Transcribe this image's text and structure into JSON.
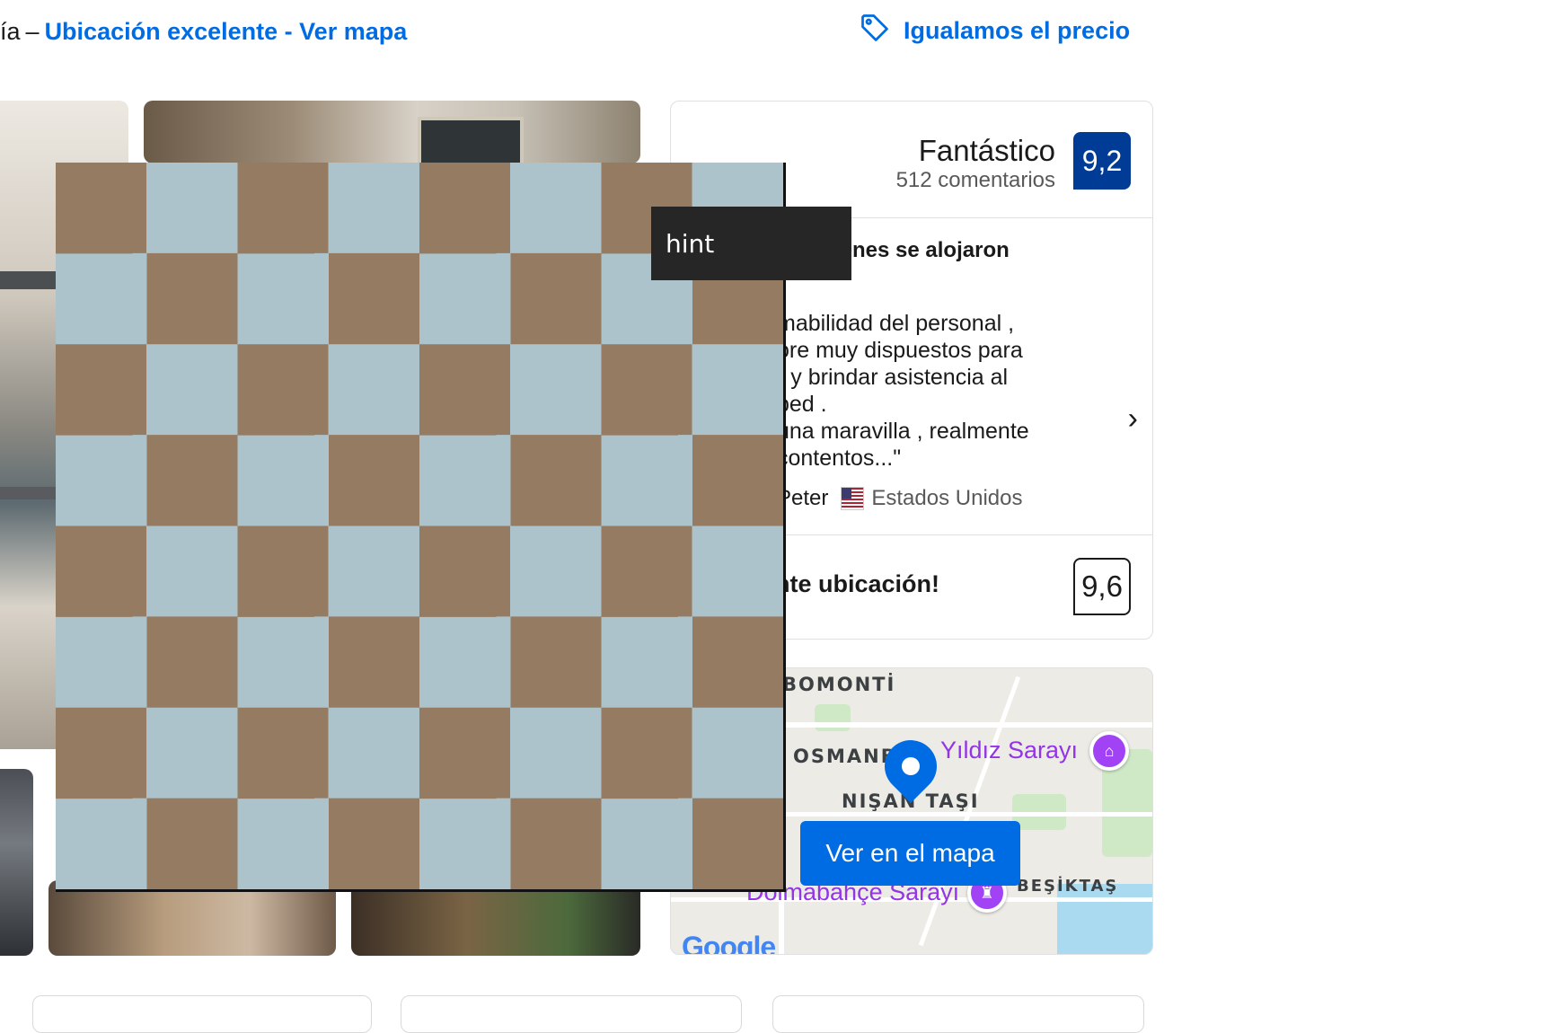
{
  "header": {
    "address_tail": "ía",
    "separator": "–",
    "location_link": "Ubicación excelente - Ver mapa",
    "price_match": "Igualamos el precio",
    "price_match_icon": "tag-icon"
  },
  "review": {
    "rating_word": "Fantástico",
    "review_count": "512 comentarios",
    "score": "9,2",
    "guest_heading": "stó a quienes se alojaron",
    "quote_lines": [
      "mabilidad del personal ,",
      "ore muy dispuestos para",
      "r y brindar asistencia al",
      "ped .",
      "una maravilla , realmente",
      "contentos...\""
    ],
    "reviewer_name": "Peter",
    "reviewer_country": "Estados Unidos",
    "location_text": "nte ubicación!",
    "location_score": "9,6",
    "colors": {
      "score_badge": "#003b95",
      "link": "#006ce4"
    }
  },
  "map": {
    "labels": {
      "bomonti": "BOMONTİ",
      "osmanbey": "OSMANB",
      "nisantasi": "NIŞAN TAŞI",
      "besiktas": "BEŞİKTAŞ"
    },
    "poi_yildiz": "Yıldız Sarayı",
    "poi_dolmabahce": "Dolmabahçe Sarayı",
    "button": "Ver en el mapa",
    "google": "Google"
  },
  "overlay": {
    "tooltip": "hint",
    "checker_colors": [
      "#adc3cb",
      "#947b62"
    ]
  }
}
